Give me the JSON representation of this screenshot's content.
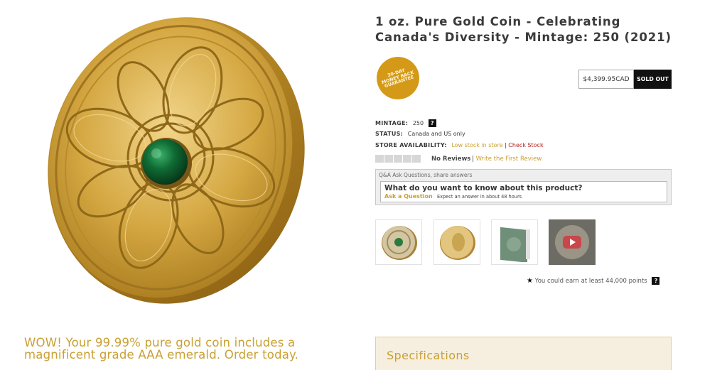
{
  "product": {
    "title": "1 oz. Pure Gold Coin - Celebrating Canada's Diversity - Mintage: 250 (2021)",
    "badge_lines": [
      "30-DAY",
      "MONEY BACK",
      "GUARANTEE"
    ],
    "price": "$4,399.95CAD",
    "stock_button": "SOLD OUT"
  },
  "details": {
    "mintage_label": "MINTAGE:",
    "mintage_value": "250",
    "status_label": "STATUS:",
    "status_value": "Canada and US only",
    "store_label": "STORE AVAILABILITY:",
    "store_value": "Low stock in store",
    "store_separator": "|",
    "check_stock": "Check Stock",
    "help_mark": "?"
  },
  "reviews": {
    "rating": 0,
    "max_rating": 5,
    "count_label": "No Reviews",
    "separator": "|",
    "write_link": "Write the First Review"
  },
  "qa": {
    "header": "Q&A Ask Questions, share answers",
    "prompt": "What do you want to know about this product?",
    "ask_link": "Ask a Question",
    "expect_text": "Expect an answer in about 48 hours"
  },
  "thumbnails": [
    {
      "name": "reverse"
    },
    {
      "name": "obverse"
    },
    {
      "name": "packaging"
    },
    {
      "name": "video"
    }
  ],
  "points": {
    "text": "You could earn at least 44,000 points",
    "help_mark": "?"
  },
  "promo": {
    "text": "WOW! Your 99.99% pure gold coin includes a magnificent grade AAA emerald. Order today."
  },
  "specifications": {
    "heading": "Specifications"
  },
  "colors": {
    "gold_accent": "#c9a032",
    "sold_out_bg": "#111111",
    "badge_bg": "#d49a17",
    "specs_bg": "#f6efe0",
    "check_stock": "#b2231e"
  }
}
